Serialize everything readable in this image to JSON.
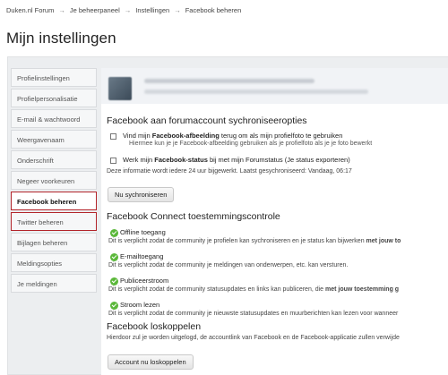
{
  "breadcrumb": [
    "Duken.nl Forum",
    "Je beheerpaneel",
    "Instellingen",
    "Facebook beheren"
  ],
  "breadcrumb_sep": "→",
  "page_title": "Mijn instellingen",
  "sidebar": {
    "items": [
      {
        "label": "Profielinstellingen"
      },
      {
        "label": "Profielpersonalisatie"
      },
      {
        "label": "E-mail & wachtwoord"
      },
      {
        "label": "Weergavenaam"
      },
      {
        "label": "Onderschrift"
      },
      {
        "label": "Negeer voorkeuren"
      },
      {
        "label": "Facebook beheren"
      },
      {
        "label": "Twitter beheren"
      },
      {
        "label": "Bijlagen beheren"
      },
      {
        "label": "Meldingsopties"
      },
      {
        "label": "Je meldingen"
      }
    ]
  },
  "sync": {
    "title": "Facebook aan forumaccount sychroniseeropties",
    "option1_prefix": "Vind mijn ",
    "option1_bold": "Facebook-afbeelding",
    "option1_suffix": " terug om als mijn profielfoto te gebruiken",
    "option1_hint": "Hiermee kun je je Facebook-afbeelding gebruiken als je profielfoto als je je foto bewerkt",
    "option2_prefix": "Werk mijn ",
    "option2_bold": "Facebook-status",
    "option2_suffix": " bij met mijn Forumstatus (Je status exporteren)",
    "info": "Deze informatie wordt iedere 24 uur bijgewerkt. Laatst gesychroniseerd: Vandaag, 06:17",
    "button": "Nu sychroniseren"
  },
  "connect": {
    "title": "Facebook Connect toestemmingscontrole",
    "perms": [
      {
        "label": "Offline toegang",
        "desc": "Dit is verplicht zodat de community je profielen kan sychroniseren en je status kan bijwerken ",
        "desc_bold": "met jouw to"
      },
      {
        "label": "E-mailtoegang",
        "desc": "Dit is verplicht zodat de community je meldingen van onderwerpen, etc. kan versturen.",
        "desc_bold": ""
      },
      {
        "label": "Publiceerstroom",
        "desc": "Dit is verplicht zodat de community statusupdates en links kan publiceren, die ",
        "desc_bold": "met jouw toestemming g"
      },
      {
        "label": "Stroom lezen",
        "desc": "Dit is verplicht zodat de community je nieuwste statusupdates en muurberichten kan lezen voor wanneer",
        "desc_bold": ""
      }
    ]
  },
  "unlink": {
    "title": "Facebook loskoppelen",
    "desc": "Hierdoor zul je worden uitgelogd, de accountlink van Facebook en de Facebook-applicatie zullen verwijde",
    "button": "Account nu loskoppelen"
  }
}
